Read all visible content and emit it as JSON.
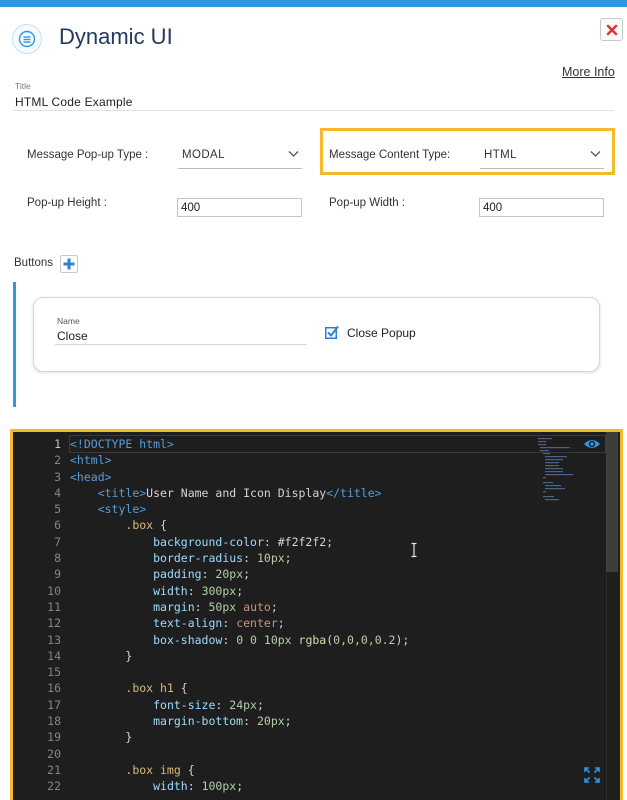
{
  "header": {
    "title": "Dynamic UI",
    "more_info": "More Info",
    "icons": {
      "app": "list-circle-icon",
      "close": "close-x-icon"
    },
    "close_color": "#e0353e"
  },
  "title_field": {
    "label": "Title",
    "value": "HTML Code Example"
  },
  "popup_type": {
    "label": "Message Pop-up Type :",
    "value": "MODAL"
  },
  "content_type": {
    "label": "Message Content Type:",
    "value": "HTML",
    "highlight_color": "#f5b92a"
  },
  "popup_height": {
    "label": "Pop-up Height :",
    "value": "400"
  },
  "popup_width": {
    "label": "Pop-up Width :",
    "value": "400"
  },
  "buttons_section": {
    "label": "Buttons",
    "accent_color": "#2f96e6",
    "items": [
      {
        "name_label": "Name",
        "name_value": "Close",
        "checkbox_label": "Close Popup",
        "checked": true
      }
    ]
  },
  "editor": {
    "background": "#1e1e1e",
    "active_line": 1,
    "lines": [
      [
        {
          "t": "tag",
          "v": "<!DOCTYPE html>"
        }
      ],
      [
        {
          "t": "tag",
          "v": "<html>"
        }
      ],
      [
        {
          "t": "tag",
          "v": "<head>"
        }
      ],
      [
        {
          "t": "text",
          "v": "    "
        },
        {
          "t": "tag",
          "v": "<title>"
        },
        {
          "t": "text",
          "v": "User Name and Icon Display"
        },
        {
          "t": "tag",
          "v": "</title>"
        }
      ],
      [
        {
          "t": "text",
          "v": "    "
        },
        {
          "t": "tag",
          "v": "<style>"
        }
      ],
      [
        {
          "t": "text",
          "v": "        "
        },
        {
          "t": "sel",
          "v": ".box"
        },
        {
          "t": "text",
          "v": " {"
        }
      ],
      [
        {
          "t": "text",
          "v": "            "
        },
        {
          "t": "prop",
          "v": "background-color"
        },
        {
          "t": "text",
          "v": ": #f2f2f2;"
        }
      ],
      [
        {
          "t": "text",
          "v": "            "
        },
        {
          "t": "prop",
          "v": "border-radius"
        },
        {
          "t": "text",
          "v": ": "
        },
        {
          "t": "num",
          "v": "10px"
        },
        {
          "t": "text",
          "v": ";"
        }
      ],
      [
        {
          "t": "text",
          "v": "            "
        },
        {
          "t": "prop",
          "v": "padding"
        },
        {
          "t": "text",
          "v": ": "
        },
        {
          "t": "num",
          "v": "20px"
        },
        {
          "t": "text",
          "v": ";"
        }
      ],
      [
        {
          "t": "text",
          "v": "            "
        },
        {
          "t": "prop",
          "v": "width"
        },
        {
          "t": "text",
          "v": ": "
        },
        {
          "t": "num",
          "v": "300px"
        },
        {
          "t": "text",
          "v": ";"
        }
      ],
      [
        {
          "t": "text",
          "v": "            "
        },
        {
          "t": "prop",
          "v": "margin"
        },
        {
          "t": "text",
          "v": ": "
        },
        {
          "t": "num",
          "v": "50px"
        },
        {
          "t": "text",
          "v": " "
        },
        {
          "t": "str",
          "v": "auto"
        },
        {
          "t": "text",
          "v": ";"
        }
      ],
      [
        {
          "t": "text",
          "v": "            "
        },
        {
          "t": "prop",
          "v": "text-align"
        },
        {
          "t": "text",
          "v": ": "
        },
        {
          "t": "str",
          "v": "center"
        },
        {
          "t": "text",
          "v": ";"
        }
      ],
      [
        {
          "t": "text",
          "v": "            "
        },
        {
          "t": "prop",
          "v": "box-shadow"
        },
        {
          "t": "text",
          "v": ": "
        },
        {
          "t": "num",
          "v": "0 0 10px"
        },
        {
          "t": "text",
          "v": " "
        },
        {
          "t": "fn",
          "v": "rgba"
        },
        {
          "t": "text",
          "v": "("
        },
        {
          "t": "num",
          "v": "0,0,0,0.2"
        },
        {
          "t": "text",
          "v": ");"
        }
      ],
      [
        {
          "t": "text",
          "v": "        }"
        }
      ],
      [],
      [
        {
          "t": "text",
          "v": "        "
        },
        {
          "t": "sel",
          "v": ".box h1"
        },
        {
          "t": "text",
          "v": " {"
        }
      ],
      [
        {
          "t": "text",
          "v": "            "
        },
        {
          "t": "prop",
          "v": "font-size"
        },
        {
          "t": "text",
          "v": ": "
        },
        {
          "t": "num",
          "v": "24px"
        },
        {
          "t": "text",
          "v": ";"
        }
      ],
      [
        {
          "t": "text",
          "v": "            "
        },
        {
          "t": "prop",
          "v": "margin-bottom"
        },
        {
          "t": "text",
          "v": ": "
        },
        {
          "t": "num",
          "v": "20px"
        },
        {
          "t": "text",
          "v": ";"
        }
      ],
      [
        {
          "t": "text",
          "v": "        }"
        }
      ],
      [],
      [
        {
          "t": "text",
          "v": "        "
        },
        {
          "t": "sel",
          "v": ".box img"
        },
        {
          "t": "text",
          "v": " {"
        }
      ],
      [
        {
          "t": "text",
          "v": "            "
        },
        {
          "t": "prop",
          "v": "width"
        },
        {
          "t": "text",
          "v": ": "
        },
        {
          "t": "num",
          "v": "100px"
        },
        {
          "t": "text",
          "v": ";"
        }
      ]
    ],
    "icons": {
      "preview": "eye-icon",
      "fullscreen": "expand-icon",
      "cursor": "text-cursor-icon"
    }
  }
}
